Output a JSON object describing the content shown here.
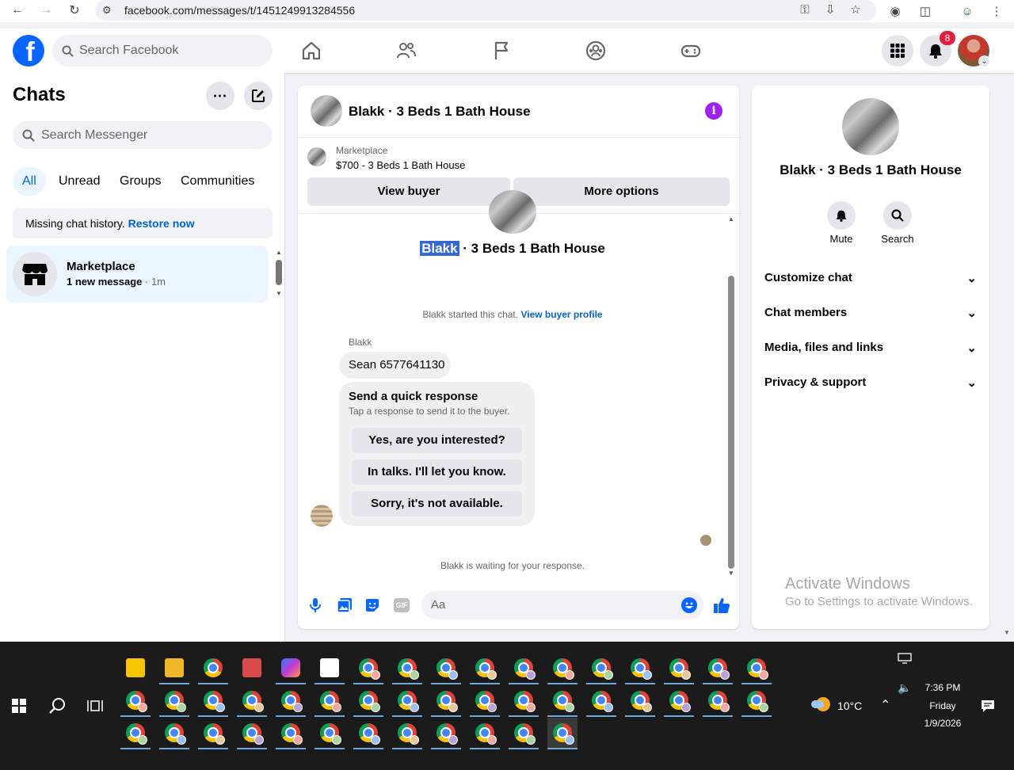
{
  "browser": {
    "url": "facebook.com/messages/t/1451249913284556"
  },
  "header": {
    "search_placeholder": "Search Facebook",
    "notification_count": "8"
  },
  "left": {
    "title": "Chats",
    "search_placeholder": "Search Messenger",
    "filters": [
      "All",
      "Unread",
      "Groups",
      "Communities"
    ],
    "banner_text": "Missing chat history.",
    "banner_link": "Restore now",
    "chat": {
      "name": "Marketplace",
      "preview": "1 new message",
      "time": "1m"
    }
  },
  "chat": {
    "title": "Blakk · 3 Beds 1 Bath House",
    "marketplace_label": "Marketplace",
    "listing": "$700 - 3 Beds 1 Bath House",
    "view_buyer": "View buyer",
    "more_options": "More options",
    "intro_name_highlight": "Blakk",
    "intro_name_rest": " · 3 Beds 1 Bath House",
    "started_text": "Blakk started this chat.",
    "buyer_profile_link": "View buyer profile",
    "sender": "Blakk",
    "message": "Sean 6577641130",
    "quick_title": "Send a quick response",
    "quick_sub": "Tap a response to send it to the buyer.",
    "quick_responses": [
      "Yes, are you interested?",
      "In talks. I'll let you know.",
      "Sorry, it's not available."
    ],
    "waiting": "Blakk is waiting for your response.",
    "composer_placeholder": "Aa"
  },
  "right": {
    "name": "Blakk · 3 Beds 1 Bath House",
    "mute": "Mute",
    "search": "Search",
    "sections": [
      "Customize chat",
      "Chat members",
      "Media, files and links",
      "Privacy & support"
    ],
    "watermark_title": "Activate Windows",
    "watermark_sub": "Go to Settings to activate Windows."
  },
  "taskbar": {
    "weather": "10°C",
    "time": "7:36 PM",
    "day": "Friday",
    "date": "1/9/2026"
  },
  "colors": {
    "accent": "#0866ff",
    "messenger_purple": "#a020f0",
    "selected_chat": "#ebf5ff"
  }
}
